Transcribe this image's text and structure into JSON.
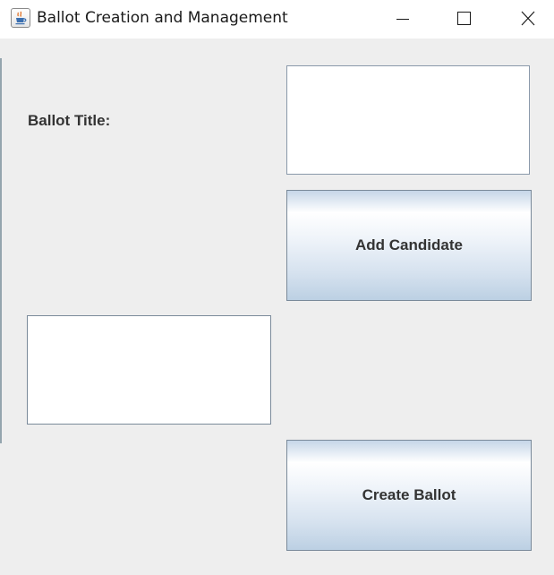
{
  "window": {
    "title": "Ballot Creation and Management"
  },
  "form": {
    "ballot_title_label": "Ballot Title:",
    "ballot_title_value": "",
    "candidate_value": "",
    "add_candidate_label": "Add Candidate",
    "create_ballot_label": "Create Ballot"
  },
  "icons": {
    "app": "java-coffee-cup-icon",
    "minimize": "minimize-icon",
    "maximize": "maximize-icon",
    "close": "close-icon"
  },
  "colors": {
    "content_background": "#eeeeee",
    "button_gradient_top": "#ffffff",
    "button_gradient_bottom": "#bcd0e3",
    "text": "#333333"
  }
}
